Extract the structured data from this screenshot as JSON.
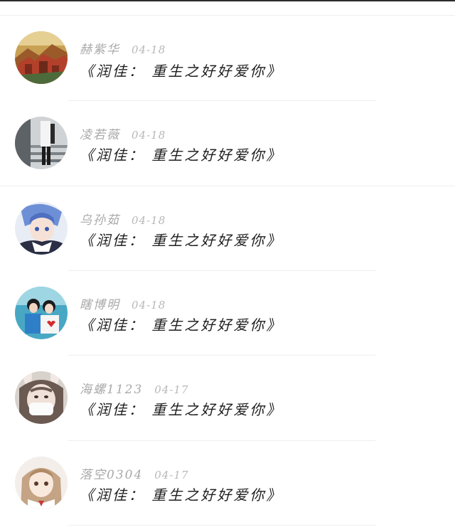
{
  "comments": [
    {
      "username": "赫紫华",
      "date": "04-18",
      "text": "《润佳： 重生之好好爱你》",
      "avatar_icon": "landscape-painting-avatar-icon"
    },
    {
      "username": "凌若薇",
      "date": "04-18",
      "text": "《润佳： 重生之好好爱你》",
      "avatar_icon": "person-on-stairs-avatar-icon"
    },
    {
      "username": "乌孙茹",
      "date": "04-18",
      "text": "《润佳： 重生之好好爱你》",
      "avatar_icon": "anime-boy-avatar-icon"
    },
    {
      "username": "瞎博明",
      "date": "04-18",
      "text": "《润佳： 重生之好好爱你》",
      "avatar_icon": "couple-photo-avatar-icon"
    },
    {
      "username": "海螺1123",
      "date": "04-17",
      "text": "《润佳： 重生之好好爱你》",
      "avatar_icon": "masked-girl-avatar-icon"
    },
    {
      "username": "落空0304",
      "date": "04-17",
      "text": "《润佳： 重生之好好爱你》",
      "avatar_icon": "anime-girl-avatar-icon"
    }
  ]
}
